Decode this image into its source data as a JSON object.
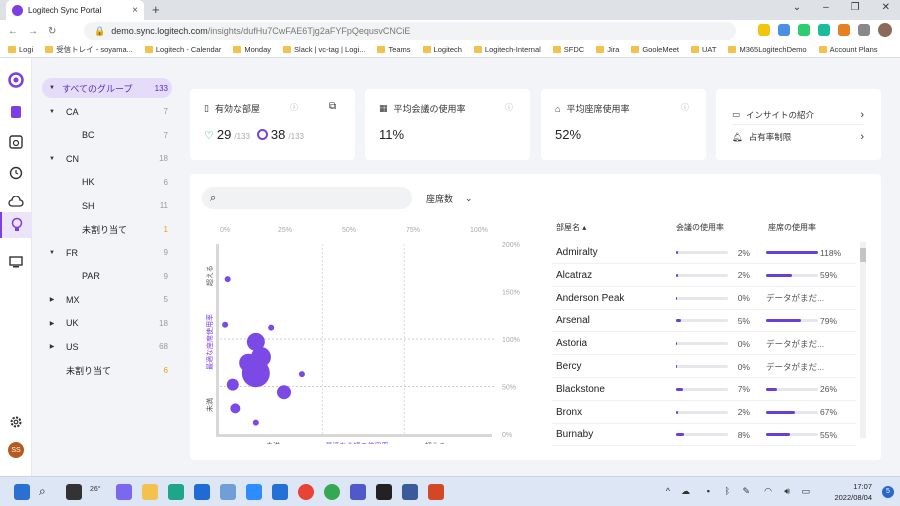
{
  "browser": {
    "tab_title": "Logitech Sync Portal",
    "url_host": "demo.sync.logitech.com",
    "url_path": "/insights/dufHu7CwFAE6Tjg2aFYFpQequsvCNCiE",
    "bookmarks": [
      "Logi",
      "受信トレイ - soyama...",
      "Logitech - Calendar",
      "Monday",
      "Slack | vc-tag | Logi...",
      "Teams",
      "Logitech",
      "Logitech-Internal",
      "SFDC",
      "Jira",
      "GooleMeet",
      "UAT",
      "M365LogitechDemo",
      "Account Plans"
    ]
  },
  "groups": [
    {
      "label": "すべてのグループ",
      "count": "133",
      "arrow": "▼",
      "indent": 0,
      "selected": true
    },
    {
      "label": "CA",
      "count": "7",
      "arrow": "▼",
      "indent": 1
    },
    {
      "label": "BC",
      "count": "7",
      "arrow": "",
      "indent": 2
    },
    {
      "label": "CN",
      "count": "18",
      "arrow": "▼",
      "indent": 1
    },
    {
      "label": "HK",
      "count": "6",
      "arrow": "",
      "indent": 2
    },
    {
      "label": "SH",
      "count": "11",
      "arrow": "",
      "indent": 2
    },
    {
      "label": "未割り当て",
      "count": "1",
      "arrow": "",
      "indent": 2,
      "warn": true
    },
    {
      "label": "FR",
      "count": "9",
      "arrow": "▼",
      "indent": 1
    },
    {
      "label": "PAR",
      "count": "9",
      "arrow": "",
      "indent": 2
    },
    {
      "label": "MX",
      "count": "5",
      "arrow": "▶",
      "indent": 1
    },
    {
      "label": "UK",
      "count": "18",
      "arrow": "▶",
      "indent": 1
    },
    {
      "label": "US",
      "count": "68",
      "arrow": "▶",
      "indent": 1
    },
    {
      "label": "未割り当て",
      "count": "6",
      "arrow": "",
      "indent": 1,
      "warn": true
    }
  ],
  "cards": {
    "rooms": {
      "title": "有効な部屋",
      "healthy": "29",
      "healthy_total": "/133",
      "sync": "38",
      "sync_total": "/133"
    },
    "meeting": {
      "title": "平均会議の使用率",
      "value": "11%"
    },
    "seat": {
      "title": "平均座席使用率",
      "value": "52%"
    },
    "insights": {
      "intro": "インサイトの紹介",
      "occupancy": "占有率制限"
    }
  },
  "panel": {
    "search_placeholder": "",
    "dropdown_label": "座席数",
    "scatter": {
      "x_ticks": [
        "0%",
        "25%",
        "50%",
        "75%",
        "100%"
      ],
      "y_ticks_right": [
        "200%",
        "150%",
        "100%",
        "50%",
        "0%"
      ],
      "y_label_top": "超える",
      "y_label_mid": "最適な座席使用率",
      "y_label_bottom": "未満",
      "x_label_left": "未満",
      "x_label_mid": "最適な会議の使用率",
      "x_label_right": "超える"
    },
    "table": {
      "col_name": "部屋名",
      "col_meeting": "会議の使用率",
      "col_seat": "座席の使用率",
      "no_data": "データがまだ...",
      "rows": [
        {
          "name": "Admiralty",
          "meeting": 2,
          "meeting_label": "2%",
          "seat": 118,
          "seat_label": "118%"
        },
        {
          "name": "Alcatraz",
          "meeting": 2,
          "meeting_label": "2%",
          "seat": 59,
          "seat_label": "59%"
        },
        {
          "name": "Anderson Peak",
          "meeting": 0,
          "meeting_label": "0%",
          "seat": null,
          "seat_label": ""
        },
        {
          "name": "Arsenal",
          "meeting": 5,
          "meeting_label": "5%",
          "seat": 79,
          "seat_label": "79%"
        },
        {
          "name": "Astoria",
          "meeting": 0,
          "meeting_label": "0%",
          "seat": null,
          "seat_label": ""
        },
        {
          "name": "Bercy",
          "meeting": 0,
          "meeting_label": "0%",
          "seat": null,
          "seat_label": ""
        },
        {
          "name": "Blackstone",
          "meeting": 7,
          "meeting_label": "7%",
          "seat": 26,
          "seat_label": "26%"
        },
        {
          "name": "Bronx",
          "meeting": 2,
          "meeting_label": "2%",
          "seat": 67,
          "seat_label": "67%"
        },
        {
          "name": "Burnaby",
          "meeting": 8,
          "meeting_label": "8%",
          "seat": 55,
          "seat_label": "55%"
        }
      ]
    }
  },
  "chart_data": {
    "type": "scatter",
    "xlabel": "最適な会議の使用率",
    "ylabel": "最適な座席使用率",
    "xlim": [
      0,
      100
    ],
    "ylim": [
      0,
      200
    ],
    "points": [
      {
        "x": 3,
        "y": 163,
        "r": 3
      },
      {
        "x": 2,
        "y": 115,
        "r": 3
      },
      {
        "x": 20,
        "y": 112,
        "r": 3
      },
      {
        "x": 14,
        "y": 97,
        "r": 9
      },
      {
        "x": 16,
        "y": 81,
        "r": 10
      },
      {
        "x": 11,
        "y": 75,
        "r": 9
      },
      {
        "x": 14,
        "y": 64,
        "r": 14
      },
      {
        "x": 32,
        "y": 63,
        "r": 3
      },
      {
        "x": 5,
        "y": 52,
        "r": 6
      },
      {
        "x": 25,
        "y": 44,
        "r": 7
      },
      {
        "x": 6,
        "y": 27,
        "r": 5
      },
      {
        "x": 14,
        "y": 12,
        "r": 3
      }
    ]
  },
  "taskbar": {
    "temp": "26°",
    "time": "17:07",
    "date": "2022/08/04",
    "notif_count": "5"
  },
  "colors": {
    "accent": "#7b3fe4",
    "bubble": "#7b4ae6",
    "bar": "#6a3fd8"
  }
}
